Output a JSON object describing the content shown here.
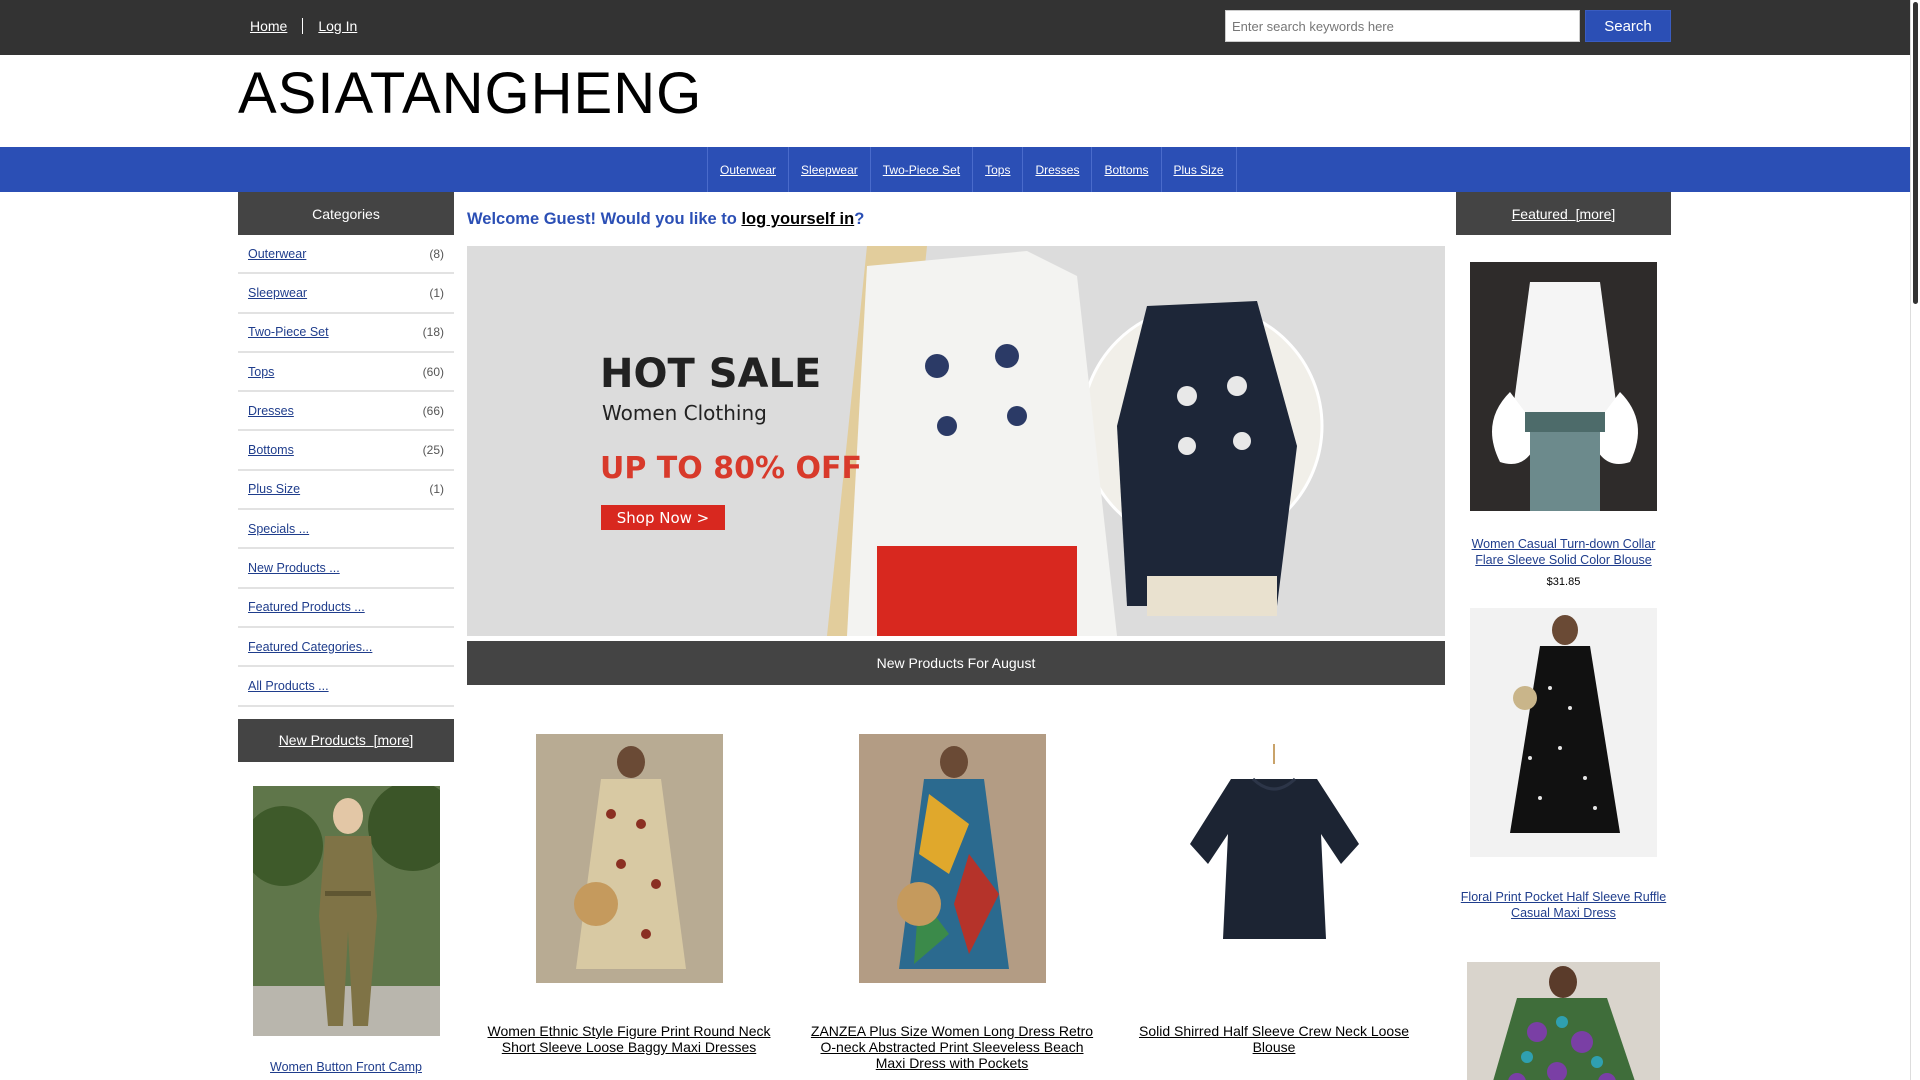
{
  "header": {
    "nav": [
      "Home",
      "Log In"
    ],
    "search_placeholder": "Enter search keywords here",
    "search_button": "Search"
  },
  "logo": "ASIATANGHENG",
  "catnav": [
    "Outerwear",
    "Sleepwear",
    "Two-Piece Set",
    "Tops",
    "Dresses",
    "Bottoms",
    "Plus Size"
  ],
  "sidebar": {
    "title": "Categories",
    "categories": [
      {
        "label": "Outerwear",
        "count": "(8)"
      },
      {
        "label": "Sleepwear",
        "count": "(1)"
      },
      {
        "label": "Two-Piece Set",
        "count": "(18)"
      },
      {
        "label": "Tops",
        "count": "(60)"
      },
      {
        "label": "Dresses",
        "count": "(66)"
      },
      {
        "label": "Bottoms",
        "count": "(25)"
      },
      {
        "label": "Plus Size",
        "count": "(1)"
      }
    ],
    "links": [
      "Specials ...",
      "New Products ...",
      "Featured Products ...",
      "Featured Categories...",
      "All Products ..."
    ],
    "new_products_title": "New Products",
    "more": "[more]",
    "new_product_name": "Women Button Front Camp"
  },
  "main": {
    "welcome_prefix": "Welcome Guest! Would you like to ",
    "welcome_link": "log yourself in",
    "welcome_suffix": "?",
    "banner": {
      "headline": "HOT SALE",
      "sub": "Women Clothing",
      "offer": "UP TO 80% OFF",
      "cta": "Shop Now >"
    },
    "section_title": "New Products For August",
    "products": [
      {
        "name": "Women Ethnic Style Figure Print Round Neck Short Sleeve Loose Baggy Maxi Dresses"
      },
      {
        "name": "ZANZEA Plus Size Women Long Dress Retro O-neck Abstracted Print Sleeveless Beach Maxi Dress with Pockets"
      },
      {
        "name": "Solid Shirred Half Sleeve Crew Neck Loose Blouse"
      }
    ]
  },
  "featured": {
    "title": "Featured",
    "more": "[more]",
    "items": [
      {
        "name": "Women Casual Turn-down Collar Flare Sleeve Solid Color Blouse",
        "price": "$31.85"
      },
      {
        "name": "Floral Print Pocket Half Sleeve Ruffle Casual Maxi Dress"
      }
    ]
  },
  "colors": {
    "topbar": "#333333",
    "accent": "#2b4fb5",
    "boxhead": "#444444",
    "offer": "#d83a2b"
  }
}
